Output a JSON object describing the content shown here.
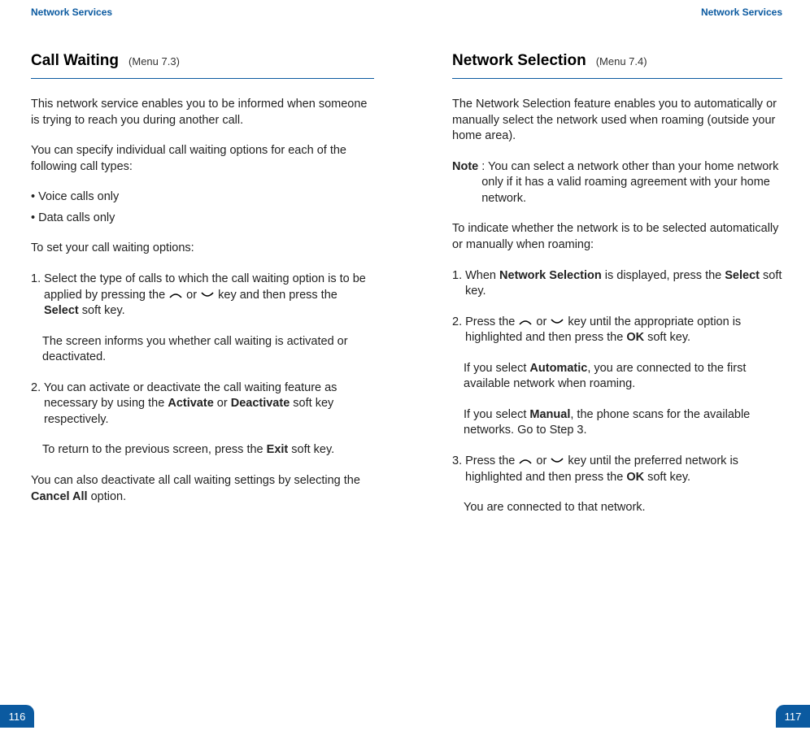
{
  "left": {
    "running_head": "Network Services",
    "title": "Call Waiting",
    "menu_ref": "(Menu 7.3)",
    "intro": "This network service enables you to be informed when someone is trying to reach you during another call.",
    "lead2": "You can specify individual call waiting options for each of the following call types:",
    "bullets": [
      "• Voice calls only",
      "• Data calls only"
    ],
    "lead3": "To set your call waiting options:",
    "step1_a": "1. Select the type of calls to which the call waiting option is to be applied by pressing the ",
    "step1_or": " or ",
    "step1_b": " key and then press the ",
    "step1_select": "Select",
    "step1_c": " soft key.",
    "step1_sub": "The screen informs you whether call waiting is activated or deactivated.",
    "step2_a": "2. You can activate or deactivate the call waiting feature as necessary by using the ",
    "step2_activate": "Activate",
    "step2_or2": " or ",
    "step2_deactivate": "Deactivate",
    "step2_b": " soft key respectively.",
    "step2_sub_a": "To return to the previous screen, press the ",
    "step2_exit": "Exit",
    "step2_sub_b": " soft key.",
    "outro_a": "You can also deactivate all call waiting settings by selecting the ",
    "outro_cancel": "Cancel All",
    "outro_b": " option.",
    "page_num": "116"
  },
  "right": {
    "running_head": "Network Services",
    "title": "Network Selection",
    "menu_ref": "(Menu 7.4)",
    "intro": "The Network Selection feature enables you to automatically or manually select the network used when roaming (outside your home area).",
    "note_label": "Note",
    "note_text": ": You can select a network other than your home network only if it has a valid roaming agreement with your home network.",
    "lead2": "To indicate whether the network is to be selected automatically or manually when roaming:",
    "step1_a": "1. When ",
    "step1_ns": "Network Selection",
    "step1_b": " is displayed, press the ",
    "step1_select": "Select",
    "step1_c": " soft key.",
    "step2_a": "2. Press the ",
    "step2_or": " or ",
    "step2_b": " key until the appropriate option is highlighted and then press the ",
    "step2_ok": "OK",
    "step2_c": " soft key.",
    "step2_sub1_a": "If you select ",
    "step2_auto": "Automatic",
    "step2_sub1_b": ", you are connected to the first available network when roaming.",
    "step2_sub2_a": "If you select ",
    "step2_manual": "Manual",
    "step2_sub2_b": ", the phone scans for the available networks. Go to Step 3.",
    "step3_a": "3. Press the ",
    "step3_or": " or ",
    "step3_b": " key until the preferred network is highlighted and then press the ",
    "step3_ok": "OK",
    "step3_c": " soft key.",
    "step3_sub": "You are connected to that network.",
    "page_num": "117"
  },
  "icons": {
    "up": "⌢",
    "down": "⌣"
  }
}
